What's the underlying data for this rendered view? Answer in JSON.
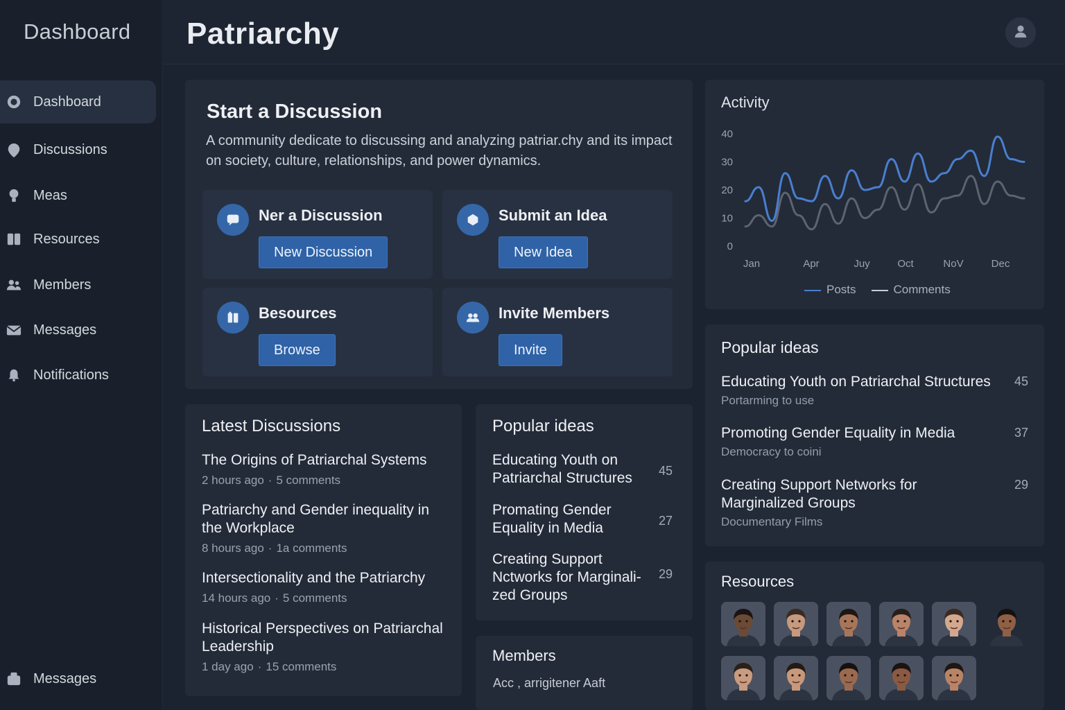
{
  "sidebar": {
    "brand": "Dashboard",
    "items": [
      {
        "label": "Dashboard",
        "icon": "dashboard-icon",
        "active": true
      },
      {
        "label": "Discussions",
        "icon": "chat-bubble-icon"
      },
      {
        "label": "Meas",
        "icon": "lightbulb-icon"
      },
      {
        "label": "Resources",
        "icon": "book-icon"
      },
      {
        "label": "Members",
        "icon": "members-icon"
      },
      {
        "label": "Messages",
        "icon": "envelope-icon"
      },
      {
        "label": "Notifications",
        "icon": "bell-icon"
      }
    ],
    "bottom_item": {
      "label": "Messages",
      "icon": "inbox-icon"
    }
  },
  "header": {
    "title": "Patriarchy",
    "profile_icon": "user-icon"
  },
  "start": {
    "title": "Start a Discussion",
    "description": "A community dedicate to discussing and analyzing patriar.chy and its impact on society, culture, relationships, and power dynamics.",
    "actions": [
      {
        "label": "Ner a Discussion",
        "button": "New Discussion",
        "icon": "chat-icon"
      },
      {
        "label": "Submit an Idea",
        "button": "New Idea",
        "icon": "idea-icon"
      },
      {
        "label": "Besources",
        "button": "Browse",
        "icon": "book-icon"
      },
      {
        "label": "Invite Members",
        "button": "Invite",
        "icon": "people-icon"
      }
    ]
  },
  "latest": {
    "title": "Latest Discussions",
    "items": [
      {
        "title": "The Origins of Patriarchal Systems",
        "time": "2 hours ago",
        "comments": "5 comments"
      },
      {
        "title": "Patriarchy and Gender inequality in the Workplace",
        "time": "8 hours ago",
        "comments": "1a comments"
      },
      {
        "title": "Intersectionality and the Patriarchy",
        "time": "14 hours ago",
        "comments": "5 comments"
      },
      {
        "title": "Historical Perspectives on Patriarchal Leadership",
        "time": "1 day ago",
        "comments": "15 comments"
      }
    ]
  },
  "popular_mid": {
    "title": "Popular ideas",
    "items": [
      {
        "title": "Educating Youth on Patriarchal Structures",
        "count": "45"
      },
      {
        "title": "Promating Gender Equality in Media",
        "count": "27"
      },
      {
        "title": "Creating Support Nctworks for Marginali-zed Groups",
        "count": "29"
      }
    ]
  },
  "members": {
    "title": "Members",
    "text": "Acc   , arrigitener  Aaft"
  },
  "activity": {
    "title": "Activity",
    "legend": [
      "Posts",
      "Comments"
    ]
  },
  "chart_data": {
    "type": "line",
    "title": "Activity",
    "x_tick_labels": [
      "Jan",
      "Apr",
      "Juy",
      "Oct",
      "NoV",
      "Dec"
    ],
    "y_tick_labels": [
      "40",
      "30",
      "20",
      "10",
      "0"
    ],
    "ylim": [
      0,
      40
    ],
    "grid": false,
    "legend_position": "bottom",
    "series": [
      {
        "name": "Posts",
        "color": "#4a7fcf",
        "values": [
          16,
          21,
          9,
          26,
          17,
          16,
          25,
          17,
          27,
          20,
          21,
          31,
          23,
          33,
          23,
          26,
          31,
          34,
          25,
          39,
          31,
          30
        ]
      },
      {
        "name": "Comments",
        "color": "#5c6470",
        "values": [
          7,
          11,
          7,
          19,
          11,
          6,
          15,
          8,
          17,
          10,
          13,
          21,
          13,
          22,
          12,
          17,
          18,
          25,
          15,
          23,
          18,
          17
        ]
      }
    ]
  },
  "popular_right": {
    "title": "Popular ideas",
    "items": [
      {
        "title": "Educating Youth on Patriarchal Structures",
        "sub": "Portarming to use",
        "count": "45"
      },
      {
        "title": "Promoting Gender Equality in Media",
        "sub": "Democracy to coini",
        "count": "37"
      },
      {
        "title": "Creating Support Networks for Marginalized Groups",
        "sub": "Documentary Films",
        "count": "29"
      }
    ]
  },
  "resources": {
    "title": "Resources",
    "faces": [
      {
        "skin": "#6b4a36",
        "hair": "#1b1412"
      },
      {
        "skin": "#c69a7e",
        "hair": "#3a2a22"
      },
      {
        "skin": "#a7765a",
        "hair": "#1e1614"
      },
      {
        "skin": "#b98468",
        "hair": "#2a1e1a"
      },
      {
        "skin": "#d3a88f",
        "hair": "#3b2a22"
      },
      {
        "skin": "#8f5f46",
        "hair": "#161110"
      },
      {
        "skin": "#c99b7f",
        "hair": "#2b2019"
      },
      {
        "skin": "#c7987a",
        "hair": "#241a15"
      },
      {
        "skin": "#9a6a50",
        "hair": "#161110"
      },
      {
        "skin": "#8a5a42",
        "hair": "#1a1311"
      },
      {
        "skin": "#b98466",
        "hair": "#1f1713"
      }
    ]
  }
}
